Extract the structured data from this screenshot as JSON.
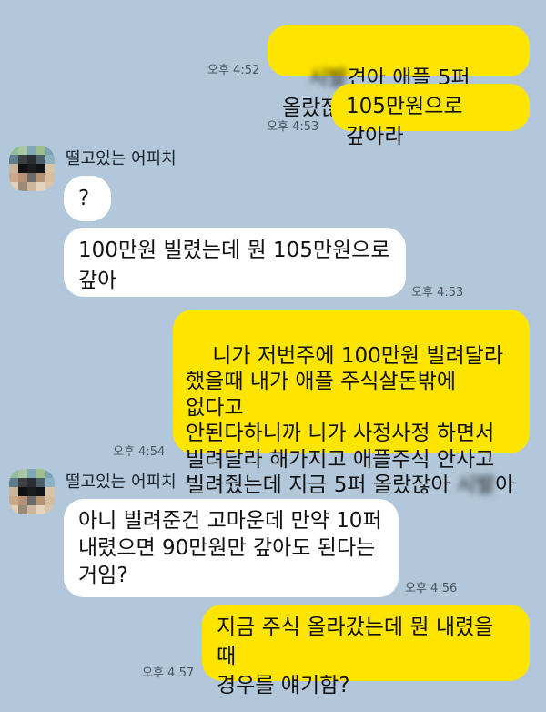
{
  "messages": [
    {
      "side": "mine",
      "text_parts": [
        "시발",
        "견아 애플 5퍼 올랐잖아"
      ],
      "time": "오후 4:52"
    },
    {
      "side": "mine",
      "text": "105만원으로 갚아라",
      "time": "오후 4:53"
    },
    {
      "sender": "떨고있는 어피치"
    },
    {
      "side": "theirs",
      "text": "?"
    },
    {
      "side": "theirs",
      "text": "100만원 빌렸는데 뭔 105만원으로\n갚아",
      "time": "오후 4:53"
    },
    {
      "side": "mine",
      "text_parts": [
        "니가 저번주에 100만원 빌려달라\n했을때 내가 애플 주식살돈밖에 없다고\n안된다하니까 니가 사정사정 하면서\n빌려달라 해가지고 애플주식 안사고\n빌려줬는데 지금 5퍼 올랐잖아 ",
        "시발",
        "아"
      ],
      "time": "오후 4:54"
    },
    {
      "sender": "떨고있는 어피치"
    },
    {
      "side": "theirs",
      "text": "아니 빌려준건 고마운데 만약 10퍼\n내렸으면 90만원만 갚아도 된다는\n거임?",
      "time": "오후 4:56"
    },
    {
      "side": "mine",
      "text": "지금 주식 올라갔는데 뭔 내렸을 때\n경우를 얘기함?",
      "time": "오후 4:57"
    }
  ]
}
